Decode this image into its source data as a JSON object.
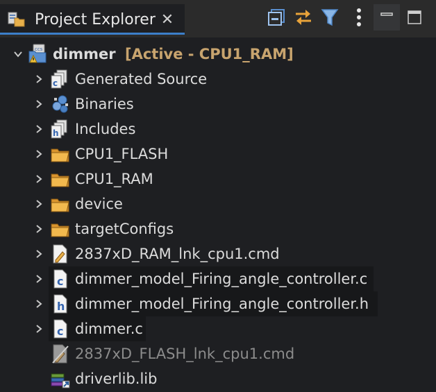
{
  "tab": {
    "title": "Project Explorer",
    "close_glyph": "✕"
  },
  "toolbar": {
    "collapse_all": "collapse-all-icon",
    "link_with_editor": "link-with-editor-icon",
    "filter": "filter-icon",
    "view_menu": "view-menu-icon",
    "minimize": "minimize-icon",
    "maximize": "maximize-icon"
  },
  "project": {
    "name": "dimmer",
    "badge": "[Active - CPU1_RAM]"
  },
  "items": [
    {
      "label": "Generated Source",
      "icon": "generated-source-icon",
      "expandable": true
    },
    {
      "label": "Binaries",
      "icon": "binaries-icon",
      "expandable": true
    },
    {
      "label": "Includes",
      "icon": "includes-icon",
      "expandable": true
    },
    {
      "label": "CPU1_FLASH",
      "icon": "folder-icon",
      "expandable": true
    },
    {
      "label": "CPU1_RAM",
      "icon": "folder-icon",
      "expandable": true
    },
    {
      "label": "device",
      "icon": "folder-icon",
      "expandable": true
    },
    {
      "label": "targetConfigs",
      "icon": "folder-icon",
      "expandable": true
    },
    {
      "label": "2837xD_RAM_lnk_cpu1.cmd",
      "icon": "cmd-file-icon",
      "expandable": true
    },
    {
      "label": "dimmer_model_Firing_angle_controller.c",
      "icon": "c-file-icon",
      "expandable": true
    },
    {
      "label": "dimmer_model_Firing_angle_controller.h",
      "icon": "h-file-icon",
      "expandable": true
    },
    {
      "label": "dimmer.c",
      "icon": "c-file-icon",
      "expandable": true
    },
    {
      "label": "2837xD_FLASH_lnk_cpu1.cmd",
      "icon": "cmd-file-excluded-icon",
      "expandable": false
    },
    {
      "label": "driverlib.lib",
      "icon": "library-icon",
      "expandable": false
    }
  ]
}
